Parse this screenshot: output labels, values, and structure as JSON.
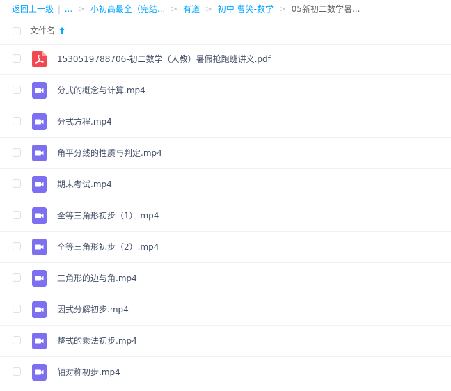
{
  "breadcrumb": {
    "back_label": "返回上一级",
    "bar": "|",
    "ellipsis": "...",
    "separator": ">",
    "items": [
      {
        "label": "小初高最全（完结..."
      },
      {
        "label": "有道"
      },
      {
        "label": "初中 曹笑-数学"
      },
      {
        "label": "05新初二数学暑..."
      }
    ]
  },
  "list_header": {
    "name_label": "文件名",
    "sort_icon": "arrow-up-icon"
  },
  "colors": {
    "link": "#06a7ff",
    "pdf_icon": "#f0494f",
    "video_icon": "#7c6ff0",
    "text": "#424e67"
  },
  "files": [
    {
      "name": "1530519788706-初二数学（人教）暑假抢跑班讲义.pdf",
      "type": "pdf",
      "icon": "pdf-icon"
    },
    {
      "name": "分式的概念与计算.mp4",
      "type": "video",
      "icon": "video-icon"
    },
    {
      "name": "分式方程.mp4",
      "type": "video",
      "icon": "video-icon"
    },
    {
      "name": "角平分线的性质与判定.mp4",
      "type": "video",
      "icon": "video-icon"
    },
    {
      "name": "期末考试.mp4",
      "type": "video",
      "icon": "video-icon"
    },
    {
      "name": "全等三角形初步（1）.mp4",
      "type": "video",
      "icon": "video-icon"
    },
    {
      "name": "全等三角形初步（2）.mp4",
      "type": "video",
      "icon": "video-icon"
    },
    {
      "name": "三角形的边与角.mp4",
      "type": "video",
      "icon": "video-icon"
    },
    {
      "name": "因式分解初步.mp4",
      "type": "video",
      "icon": "video-icon"
    },
    {
      "name": "整式的乘法初步.mp4",
      "type": "video",
      "icon": "video-icon"
    },
    {
      "name": "轴对称初步.mp4",
      "type": "video",
      "icon": "video-icon"
    }
  ]
}
